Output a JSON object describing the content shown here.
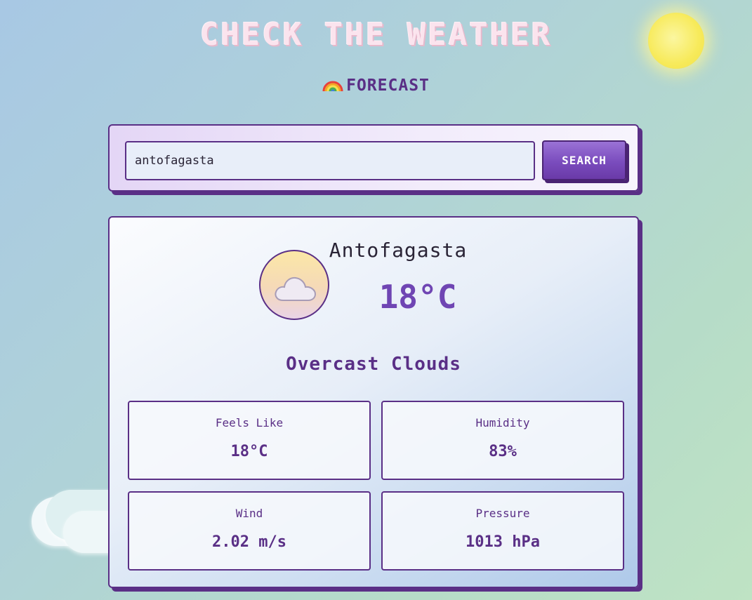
{
  "header": {
    "title": "CHECK THE WEATHER",
    "subtitle": "FORECAST",
    "subtitle_icon": "rainbow-icon"
  },
  "search": {
    "value": "antofagasta",
    "button_label": "SEARCH"
  },
  "weather": {
    "city": "Antofagasta",
    "temperature": "18°C",
    "condition": "Overcast Clouds",
    "icon": "cloud-icon",
    "stats": {
      "feels_like": {
        "label": "Feels Like",
        "value": "18°C"
      },
      "humidity": {
        "label": "Humidity",
        "value": "83%"
      },
      "wind": {
        "label": "Wind",
        "value": "2.02 m/s"
      },
      "pressure": {
        "label": "Pressure",
        "value": "1013 hPa"
      }
    }
  },
  "colors": {
    "accent": "#5a2f86",
    "temperature": "#6f45b3",
    "button": "#7a4cbd",
    "title": "#fbe4ee",
    "sun": "#f7ea5a"
  }
}
